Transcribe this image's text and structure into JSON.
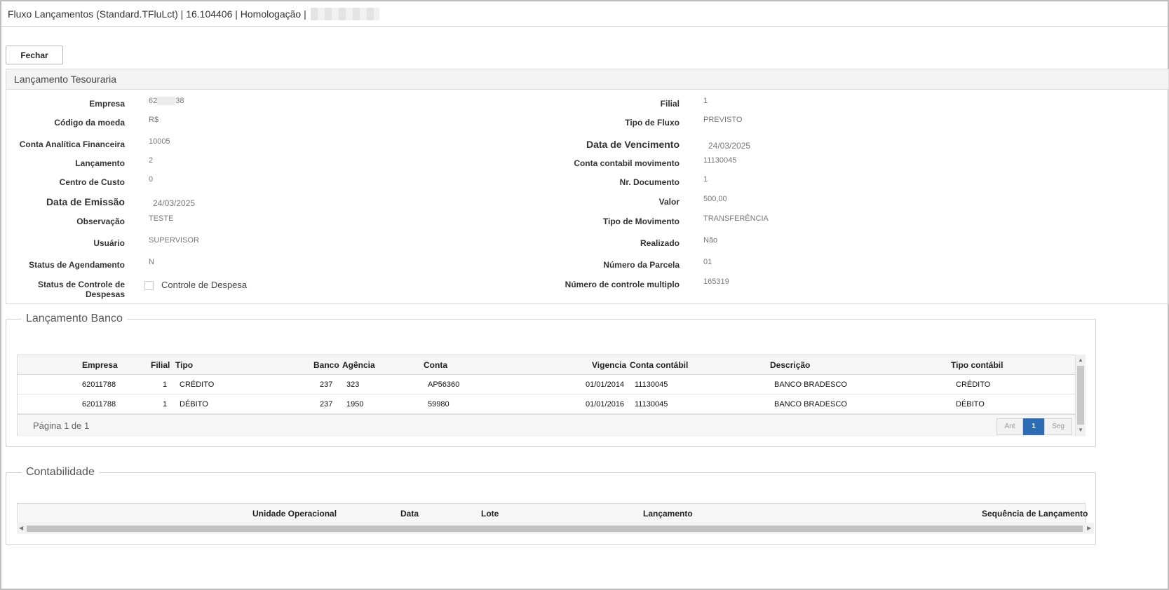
{
  "window": {
    "title": "Fluxo Lançamentos (Standard.TFluLct) | 16.104406 | Homologação |"
  },
  "toolbar": {
    "close_label": "Fechar"
  },
  "tesouraria": {
    "title": "Lançamento Tesouraria",
    "empresa": {
      "label": "Empresa",
      "value_prefix": "62",
      "value_suffix": "38"
    },
    "filial": {
      "label": "Filial",
      "value": "1"
    },
    "codigo_moeda": {
      "label": "Código da moeda",
      "value": "R$"
    },
    "tipo_fluxo": {
      "label": "Tipo de Fluxo",
      "value": "PREVISTO"
    },
    "conta_analitica": {
      "label": "Conta Analítica Financeira",
      "value": "10005"
    },
    "data_vencimento": {
      "label": "Data de Vencimento",
      "value": "24/03/2025"
    },
    "lancamento": {
      "label": "Lançamento",
      "value": "2"
    },
    "conta_contabil_mov": {
      "label": "Conta contabil movimento",
      "value": "11130045"
    },
    "centro_custo": {
      "label": "Centro de Custo",
      "value": "0"
    },
    "nr_documento": {
      "label": "Nr. Documento",
      "value": "1"
    },
    "data_emissao": {
      "label": "Data de Emissão",
      "value": "24/03/2025"
    },
    "valor": {
      "label": "Valor",
      "value": "500,00"
    },
    "observacao": {
      "label": "Observação",
      "value": "TESTE"
    },
    "tipo_movimento": {
      "label": "Tipo de Movimento",
      "value": "TRANSFERÊNCIA"
    },
    "usuario": {
      "label": "Usuário",
      "value": "SUPERVISOR"
    },
    "realizado": {
      "label": "Realizado",
      "value": "Não"
    },
    "status_agendamento": {
      "label": "Status de Agendamento",
      "value": "N"
    },
    "numero_parcela": {
      "label": "Número da Parcela",
      "value": "01"
    },
    "status_controle": {
      "label_line1": "Status de Controle de",
      "label_line2": "Despesas",
      "checkbox_label": "Controle de Despesa",
      "checked": false
    },
    "numero_controle": {
      "label": "Número de controle multiplo",
      "value": "165319"
    }
  },
  "banco": {
    "title": "Lançamento Banco",
    "columns": [
      "Empresa",
      "Filial",
      "Tipo",
      "Banco",
      "Agência",
      "Conta",
      "Vigencia",
      "Conta contábil",
      "Descrição",
      "Tipo contábil"
    ],
    "rows": [
      [
        "62011788",
        "1",
        "CRÉDITO",
        "237",
        "323",
        "AP56360",
        "01/01/2014",
        "11130045",
        "BANCO BRADESCO",
        "CRÉDITO"
      ],
      [
        "62011788",
        "1",
        "DÉBITO",
        "237",
        "1950",
        "59980",
        "01/01/2016",
        "11130045",
        "BANCO BRADESCO",
        "DÉBITO"
      ]
    ],
    "pager": {
      "info": "Página 1 de 1",
      "prev": "Ant",
      "current": "1",
      "next": "Seg"
    }
  },
  "contabilidade": {
    "title": "Contabilidade",
    "columns": [
      "Unidade Operacional",
      "Data",
      "Lote",
      "Lançamento",
      "Sequência de Lançamento"
    ]
  }
}
